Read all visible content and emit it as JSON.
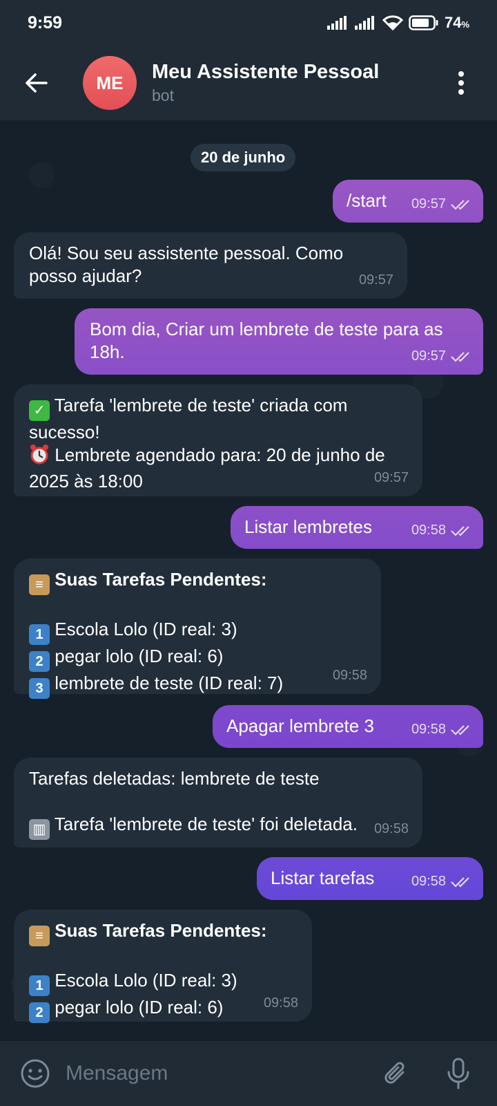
{
  "status_bar": {
    "time": "9:59",
    "battery_percent": "74",
    "percent_sign": "%"
  },
  "header": {
    "avatar_initials": "ME",
    "title": "Meu Assistente Pessoal",
    "subtitle": "bot",
    "avatar_color": "#e4575c"
  },
  "date_chip": "20 de junho",
  "colors": {
    "outgoing_bubble_top": "#9b59c8",
    "outgoing_bubble_bottom": "#6a4ed8",
    "incoming_bubble": "#222e3a",
    "chat_background": "#16202a"
  },
  "messages": [
    {
      "dir": "out",
      "text": "/start",
      "time": "09:57",
      "read": true
    },
    {
      "dir": "in",
      "text": "Olá! Sou seu assistente pessoal. Como posso ajudar?",
      "time": "09:57"
    },
    {
      "dir": "out",
      "text": "Bom dia, Criar um lembrete de teste para as 18h.",
      "time": "09:57",
      "read": true
    },
    {
      "dir": "in",
      "line1": "Tarefa 'lembrete de teste' criada com sucesso!",
      "line2": "Lembrete agendado para: 20 de junho de 2025 às 18:00",
      "icon1": "check-mark-emoji",
      "icon2": "alarm-clock-emoji",
      "time": "09:57"
    },
    {
      "dir": "out",
      "text": "Listar lembretes",
      "time": "09:58",
      "read": true
    },
    {
      "dir": "in",
      "heading": "Suas Tarefas Pendentes:",
      "items": [
        "Escola Lolo (ID real: 3)",
        "pegar lolo (ID real: 6)",
        "lembrete de teste (ID real: 7)"
      ],
      "item_numbers": [
        "1",
        "2",
        "3"
      ],
      "time": "09:58"
    },
    {
      "dir": "out",
      "text": "Apagar lembrete 3",
      "time": "09:58",
      "read": true
    },
    {
      "dir": "in",
      "line1": "Tarefas deletadas: lembrete de teste",
      "line2": "Tarefa 'lembrete de teste' foi deletada.",
      "icon2": "wastebasket-emoji",
      "time": "09:58"
    },
    {
      "dir": "out",
      "text": "Listar tarefas",
      "time": "09:58",
      "read": true
    },
    {
      "dir": "in",
      "heading": "Suas Tarefas Pendentes:",
      "items": [
        "Escola Lolo (ID real: 3)",
        "pegar lolo (ID real: 6)"
      ],
      "item_numbers": [
        "1",
        "2"
      ],
      "time": "09:58"
    }
  ],
  "input": {
    "placeholder": "Mensagem"
  }
}
